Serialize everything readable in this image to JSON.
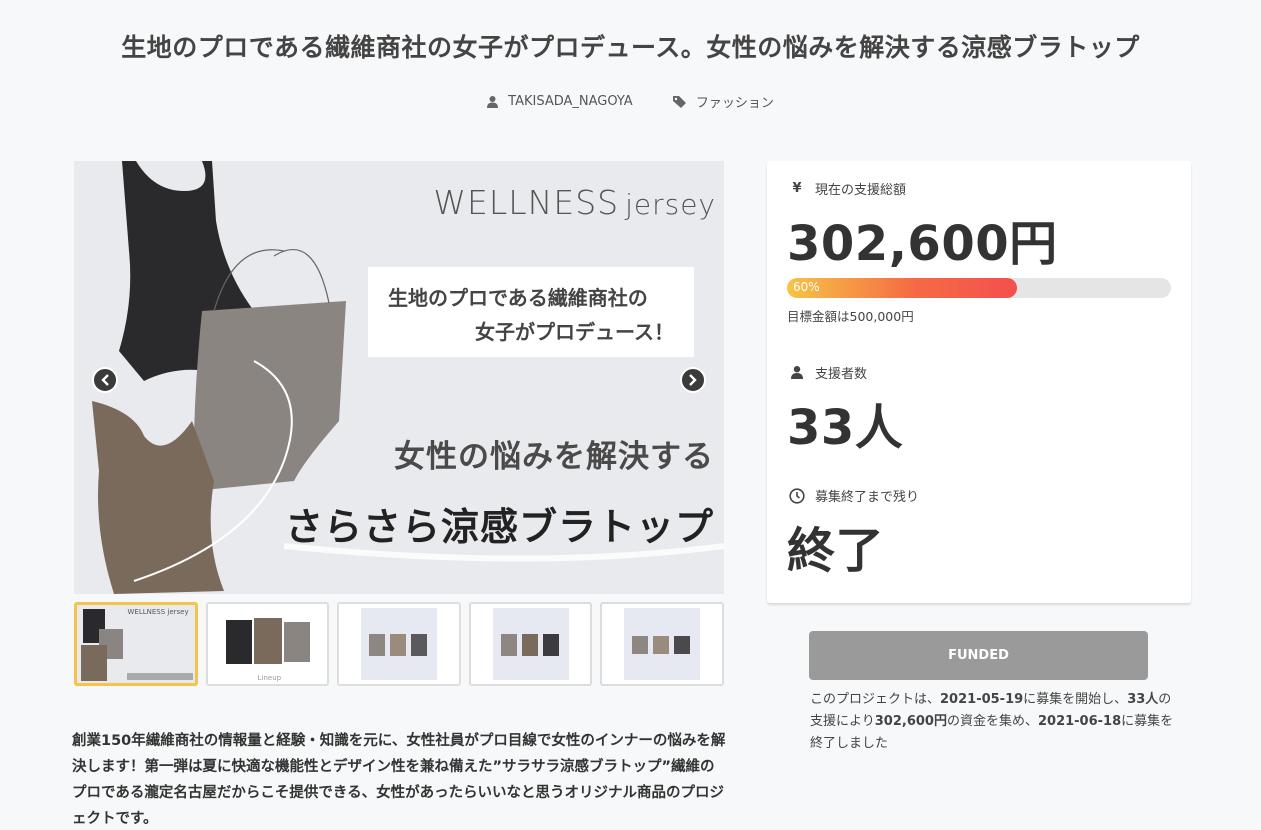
{
  "title": "生地のプロである繊維商社の女子がプロデュース。女性の悩みを解決する涼感ブラトップ",
  "meta": {
    "author": "TAKISADA_NAGOYA",
    "category": "ファッション"
  },
  "hero": {
    "brand_main": "WELLNESS",
    "brand_sub": "jersey",
    "card_line1": "生地のプロである繊維商社の",
    "card_line2": "女子がプロデュース！",
    "headline1": "女性の悩みを解決する",
    "headline2": "さらさら涼感ブラトップ"
  },
  "thumbnails": [
    {
      "label": "WELLNESS jersey"
    },
    {
      "label": "Lineup"
    },
    {
      "label": ""
    },
    {
      "label": ""
    },
    {
      "label": ""
    }
  ],
  "description": "創業150年繊維商社の情報量と経験・知識を元に、女性社員がプロ目線で女性のインナーの悩みを解決します！第一弾は夏に快適な機能性とデザイン性を兼ね備えた”サラサラ涼感ブラトップ”繊維のプロである瀧定名古屋だからこそ提供できる、女性があったらいいなと思うオリジナル商品のプロジェクトです。",
  "panel": {
    "total_label": "現在の支援総額",
    "total_value": "302,600円",
    "progress_label": "60%",
    "progress_fraction": 0.6,
    "goal": "目標金額は500,000円",
    "backers_label": "支援者数",
    "backers_value": "33人",
    "remaining_label": "募集終了まで残り",
    "remaining_value": "終了"
  },
  "funded_button": "FUNDED",
  "summary": {
    "p1": "このプロジェクトは、",
    "start": "2021-05-19",
    "p2": "に募集を開始し、",
    "backers": "33人",
    "p3": "の支援により",
    "amount": "302,600円",
    "p4": "の資金を集め、",
    "end": "2021-06-18",
    "p5": "に募集を終了しました"
  },
  "colors": {
    "accent": "#f44f4d",
    "progress_start": "#f7c447",
    "funded": "#9a9a9a"
  }
}
